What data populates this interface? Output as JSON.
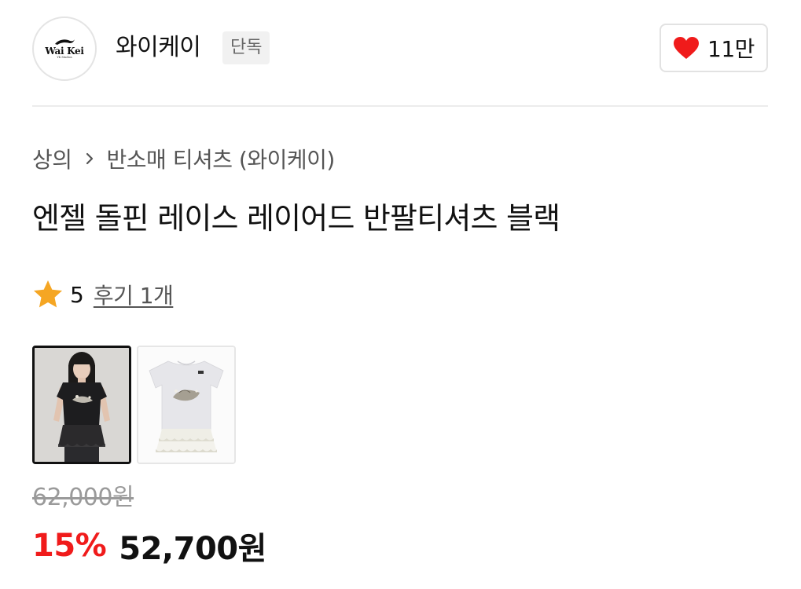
{
  "brand": {
    "logo_text": "Wai Kei",
    "logo_subtext": "YK Studios",
    "name": "와이케이",
    "badge": "단독"
  },
  "like": {
    "count": "11만",
    "icon": "heart-icon",
    "color": "#f01b1b"
  },
  "breadcrumb": {
    "category": "상의",
    "separator_icon": "chevron-right-icon",
    "subcategory": "반소매 티셔츠 (와이케이)"
  },
  "product": {
    "title": "엔젤 돌핀 레이스 레이어드 반팔티셔츠 블랙"
  },
  "rating": {
    "icon": "star-icon",
    "icon_color": "#f5a623",
    "score": "5",
    "review_label": "후기 1개"
  },
  "thumbnails": [
    {
      "description": "model-wearing-black-tee",
      "selected": true
    },
    {
      "description": "white-tee-flat-lay",
      "selected": false
    }
  ],
  "price": {
    "original": "62,000원",
    "discount_rate": "15%",
    "sale": "52,700원",
    "discount_color": "#f01b1b"
  }
}
